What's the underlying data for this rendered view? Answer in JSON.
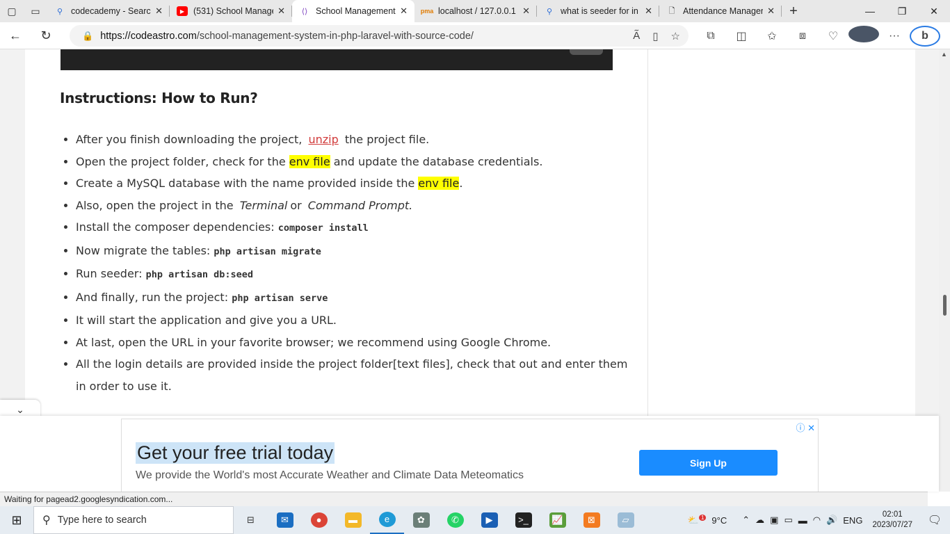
{
  "browser": {
    "tabs": [
      {
        "title": "codecademy - Searc",
        "icon": "search-icon",
        "active": false
      },
      {
        "title": "(531) School Manage",
        "icon": "youtube-icon",
        "active": false
      },
      {
        "title": "School Management",
        "icon": "codeastro-icon",
        "active": true
      },
      {
        "title": "localhost / 127.0.0.1",
        "icon": "phpmyadmin-icon",
        "active": false
      },
      {
        "title": "what is seeder for in",
        "icon": "search-icon",
        "active": false
      },
      {
        "title": "Attendance Manager",
        "icon": "page-icon",
        "active": false
      }
    ],
    "url_host": "https://codeastro.com",
    "url_path": "/school-management-system-in-php-laravel-with-source-code/"
  },
  "article": {
    "heading": "Instructions: How to Run?",
    "steps": {
      "s1_a": "After you finish downloading the project,",
      "s1_link": "unzip",
      "s1_b": "the project file.",
      "s2_a": "Open the project folder, check for the",
      "s2_hl": "env file",
      "s2_b": "and update the database credentials.",
      "s3_a": "Create a MySQL database with the name provided inside the",
      "s3_hl": "env file",
      "s3_b": ".",
      "s4_a": "Also, open the project in the",
      "s4_i1": "Terminal",
      "s4_b": "or",
      "s4_i2": "Command Prompt.",
      "s5_a": "Install the composer dependencies:",
      "s5_code": "composer install",
      "s6_a": "Now migrate the tables:",
      "s6_code": "php artisan migrate",
      "s7_a": "Run seeder:",
      "s7_code": "php artisan db:seed",
      "s8_a": "And finally, run the project:",
      "s8_code": "php artisan serve",
      "s9": "It will start the application and give you a URL.",
      "s10": "At last, open the URL in your favorite browser; we recommend using Google Chrome.",
      "s11": "All the login details are provided inside the project folder[text files], check that out and enter them in order to use it."
    }
  },
  "ad": {
    "headline": "Get your free trial today",
    "subtext": "We provide the World's most Accurate Weather and Climate Data Meteomatics",
    "cta": "Sign Up"
  },
  "status_text": "Waiting for pagead2.googlesyndication.com...",
  "taskbar": {
    "search_placeholder": "Type here to search",
    "weather": "9°C",
    "weather_badge": "1",
    "language": "ENG",
    "time": "02:01",
    "date": "2023/07/27"
  },
  "colors": {
    "highlight": "#ffff00",
    "link": "#d13a3a",
    "cta": "#1a8cff"
  }
}
